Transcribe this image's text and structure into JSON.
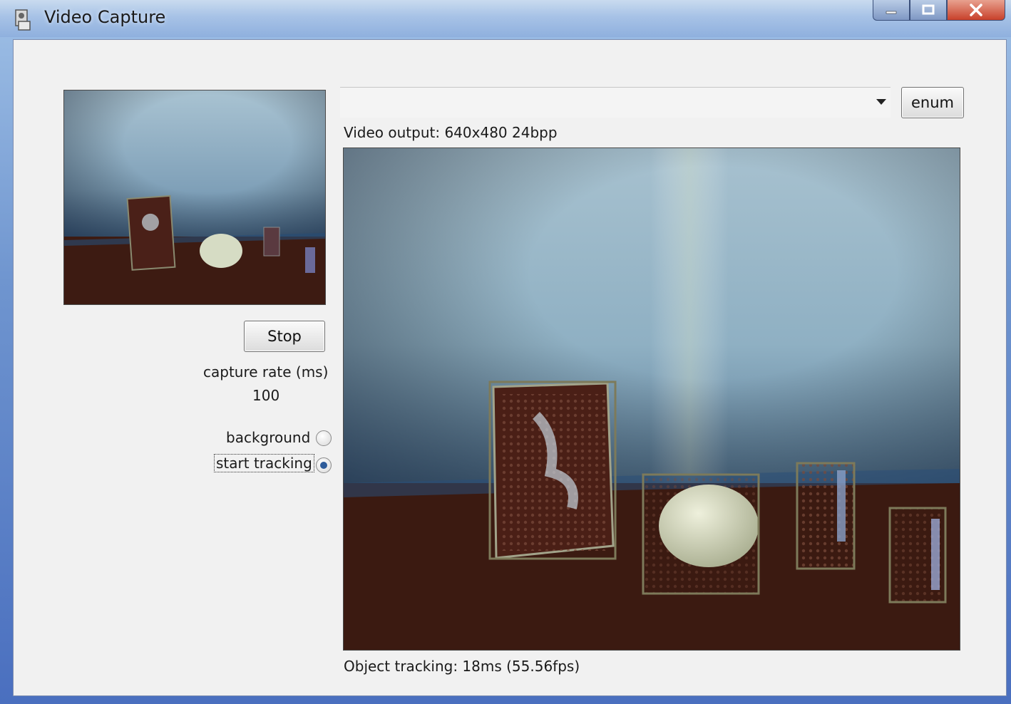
{
  "window": {
    "title": "Video Capture",
    "app_icon": "camera-app-icon",
    "controls": {
      "minimize": "minimize-icon",
      "maximize": "maximize-icon",
      "close": "close-icon"
    }
  },
  "device": {
    "combo_value": "",
    "enum_label": "enum"
  },
  "left_panel": {
    "stop_label": "Stop",
    "rate_label": "capture rate (ms)",
    "rate_value": "100",
    "background_label": "background",
    "tracking_label": "start tracking",
    "selected_mode": "start tracking"
  },
  "video": {
    "output_label": "Video output: 640x480 24bpp",
    "status_label": "Object tracking:  18ms (55.56fps)",
    "tracked_object_count": 4
  },
  "colors": {
    "wall": "#8fb3c8",
    "table": "#3a1a10",
    "tracking_box": "#7d7a5a"
  }
}
